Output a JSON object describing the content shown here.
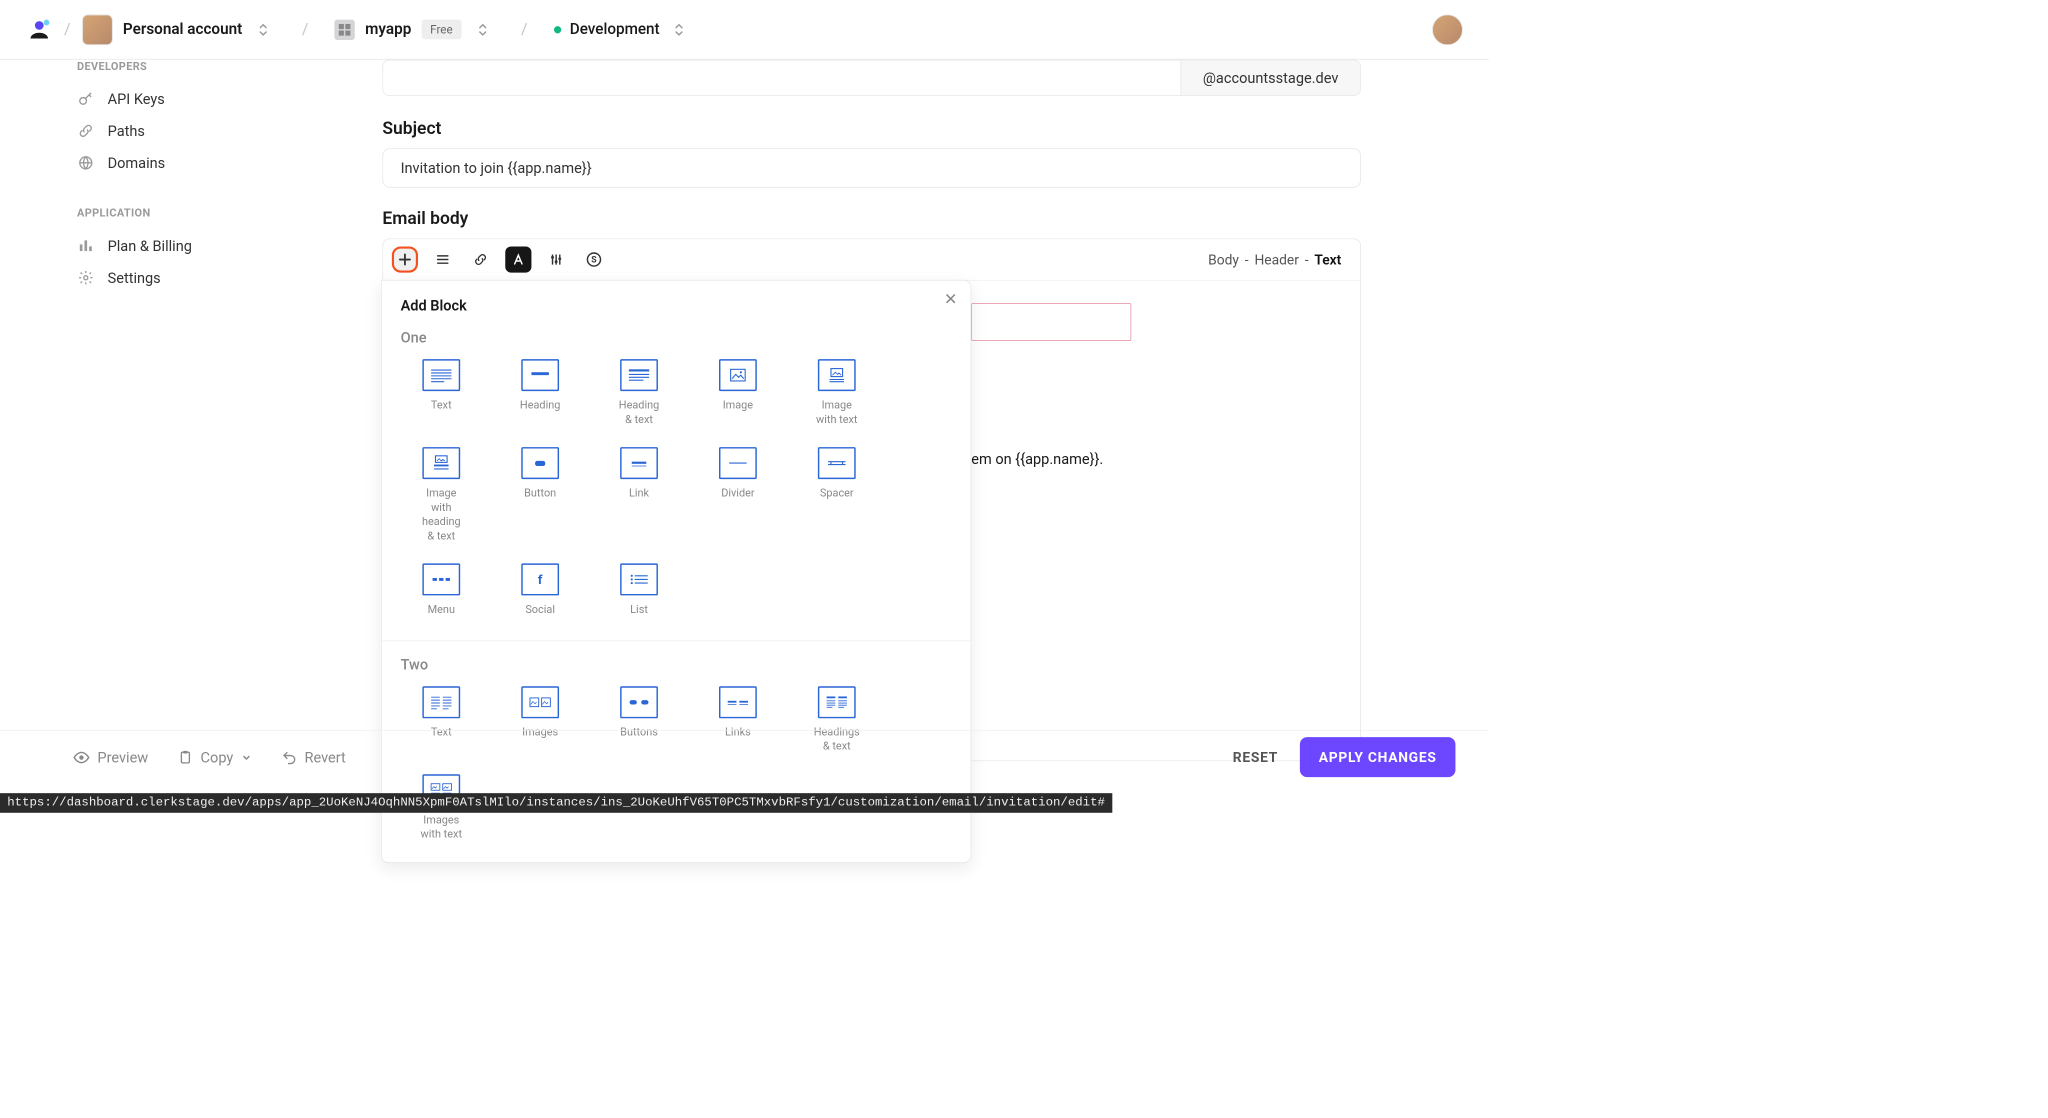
{
  "nav": {
    "account": "Personal account",
    "app": "myapp",
    "plan_badge": "Free",
    "environment": "Development"
  },
  "sidebar": {
    "section_developers": "DEVELOPERS",
    "items_dev": [
      "API Keys",
      "Paths",
      "Domains"
    ],
    "section_application": "APPLICATION",
    "items_app": [
      "Plan & Billing",
      "Settings"
    ]
  },
  "form": {
    "from_domain": "@accountsstage.dev",
    "subject_label": "Subject",
    "subject_value": "Invitation to join {{app.name}}",
    "body_label": "Email body"
  },
  "toolbar": {
    "breadcrumb": [
      "Body",
      "Header",
      "Text"
    ]
  },
  "popover": {
    "title": "Add Block",
    "section_one": "One",
    "section_two": "Two",
    "blocks_one": [
      "Text",
      "Heading",
      "Heading & text",
      "Image",
      "Image with text",
      "Image with heading & text",
      "Button",
      "Link",
      "Divider",
      "Spacer",
      "Menu",
      "Social",
      "List"
    ],
    "blocks_two": [
      "Text",
      "Images",
      "Buttons",
      "Links",
      "Headings & text",
      "Images with text"
    ]
  },
  "canvas": {
    "peek_text": "em on {{app.name}}."
  },
  "footer": {
    "preview": "Preview",
    "copy": "Copy",
    "revert": "Revert",
    "reset": "RESET",
    "apply": "APPLY CHANGES"
  },
  "statusbar": "https://dashboard.clerkstage.dev/apps/app_2UoKeNJ4OqhNN5XpmF0ATslMIlo/instances/ins_2UoKeUhfV65T0PC5TMxvbRFsfy1/customization/email/invitation/edit#"
}
